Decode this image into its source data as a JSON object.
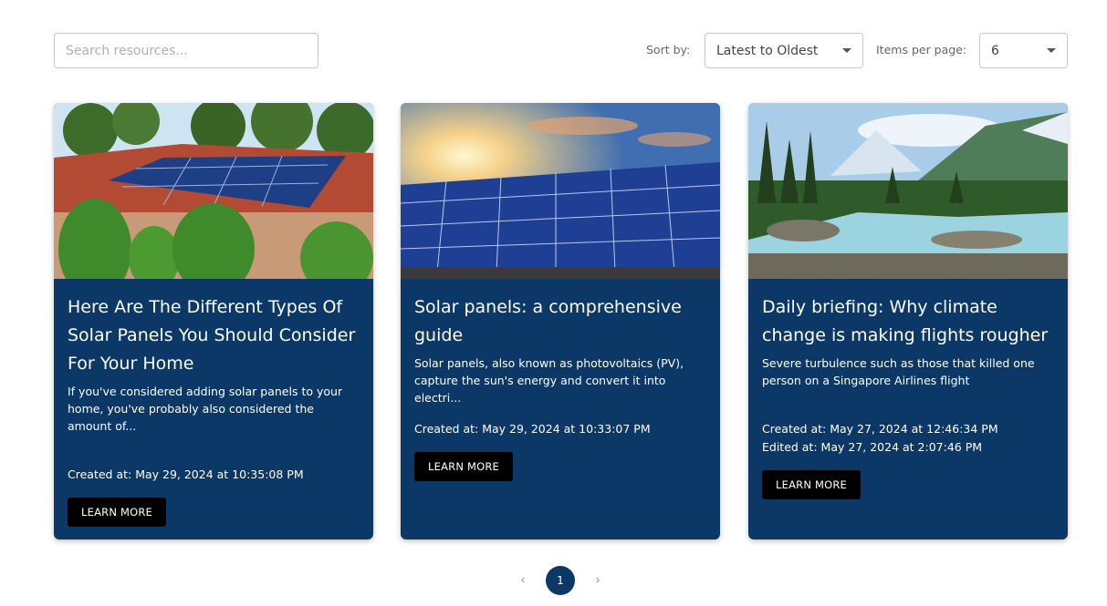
{
  "toolbar": {
    "search_placeholder": "Search resources...",
    "sort_label": "Sort by:",
    "sort_value": "Latest to Oldest",
    "items_per_page_label": "Items per page:",
    "items_per_page_value": "6"
  },
  "cards": [
    {
      "title": "Here Are The Different Types Of Solar Panels You Should Consider For Your Home",
      "description": "If you've considered adding solar panels to your home, you've probably also considered the amount of...",
      "created": "Created at: May 29, 2024 at 10:35:08 PM",
      "edited": "",
      "button": "LEARN MORE"
    },
    {
      "title": "Solar panels: a comprehensive guide",
      "description": "Solar panels, also known as photovoltaics (PV), capture the sun's energy and convert it into electri...",
      "created": "Created at: May 29, 2024 at 10:33:07 PM",
      "edited": "",
      "button": "LEARN MORE"
    },
    {
      "title": "Daily briefing: Why climate change is making flights rougher",
      "description": "Severe turbulence such as those that killed one person on a Singapore Airlines flight",
      "created": "Created at: May 27, 2024 at 12:46:34 PM",
      "edited": "Edited at: May 27, 2024 at 2:07:46 PM",
      "button": "LEARN MORE"
    }
  ],
  "pagination": {
    "prev": "‹",
    "current": "1",
    "next": "›"
  },
  "colors": {
    "card_bg": "#0b3866",
    "button_bg": "#000000",
    "page_bg": "#ffffff"
  }
}
